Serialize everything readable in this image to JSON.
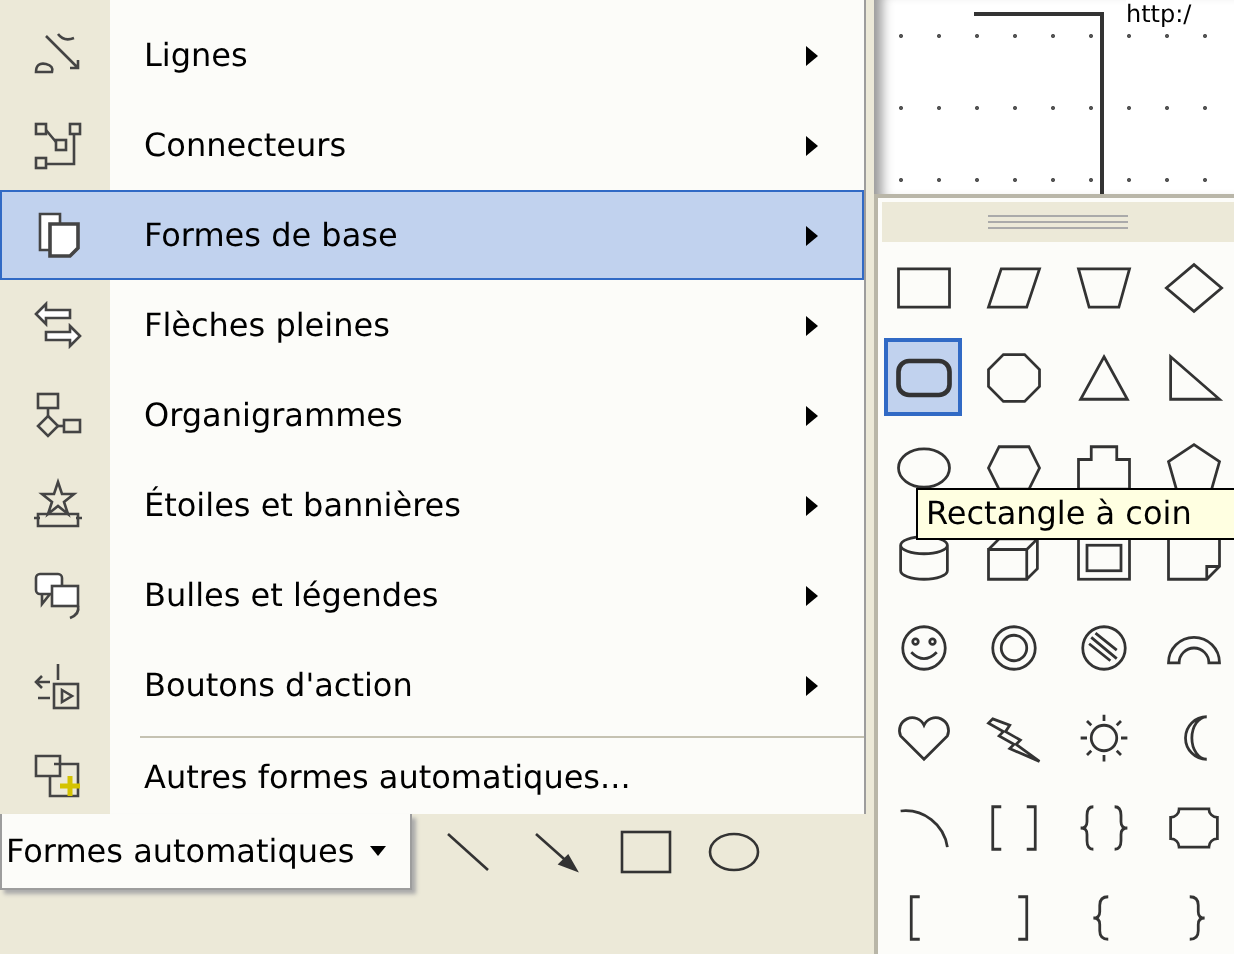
{
  "menu": {
    "items": [
      {
        "label": "Lignes",
        "has_submenu": true,
        "selected": false
      },
      {
        "label": "Connecteurs",
        "has_submenu": true,
        "selected": false
      },
      {
        "label": "Formes de base",
        "has_submenu": true,
        "selected": true
      },
      {
        "label": "Flèches pleines",
        "has_submenu": true,
        "selected": false
      },
      {
        "label": "Organigrammes",
        "has_submenu": true,
        "selected": false
      },
      {
        "label": "Étoiles et bannières",
        "has_submenu": true,
        "selected": false
      },
      {
        "label": "Bulles et légendes",
        "has_submenu": true,
        "selected": false
      },
      {
        "label": "Boutons d'action",
        "has_submenu": true,
        "selected": false
      },
      {
        "label": "Autres formes automatiques...",
        "has_submenu": false,
        "selected": false,
        "separator_before": true
      }
    ]
  },
  "toolbar": {
    "autoshapes_button": "Formes automatiques"
  },
  "canvas": {
    "text": "http:/"
  },
  "palette": {
    "shapes": [
      {
        "kind": "rectangle",
        "selected": false
      },
      {
        "kind": "parallelogram",
        "selected": false
      },
      {
        "kind": "trapezoid",
        "selected": false
      },
      {
        "kind": "diamond",
        "selected": false
      },
      {
        "kind": "rounded-rectangle",
        "selected": true
      },
      {
        "kind": "octagon",
        "selected": false
      },
      {
        "kind": "triangle",
        "selected": false
      },
      {
        "kind": "right-triangle",
        "selected": false
      },
      {
        "kind": "oval",
        "selected": false
      },
      {
        "kind": "hexagon",
        "selected": false
      },
      {
        "kind": "cross",
        "selected": false
      },
      {
        "kind": "pentagon",
        "selected": false
      },
      {
        "kind": "can",
        "selected": false
      },
      {
        "kind": "cube",
        "selected": false
      },
      {
        "kind": "bevel",
        "selected": false
      },
      {
        "kind": "folded-corner",
        "selected": false
      },
      {
        "kind": "smiley",
        "selected": false
      },
      {
        "kind": "donut",
        "selected": false
      },
      {
        "kind": "no-symbol",
        "selected": false
      },
      {
        "kind": "block-arc",
        "selected": false
      },
      {
        "kind": "heart",
        "selected": false
      },
      {
        "kind": "lightning",
        "selected": false
      },
      {
        "kind": "sun",
        "selected": false
      },
      {
        "kind": "moon",
        "selected": false
      },
      {
        "kind": "arc",
        "selected": false
      },
      {
        "kind": "double-bracket",
        "selected": false
      },
      {
        "kind": "double-brace",
        "selected": false
      },
      {
        "kind": "plaque",
        "selected": false
      },
      {
        "kind": "left-bracket",
        "selected": false
      },
      {
        "kind": "right-bracket",
        "selected": false
      },
      {
        "kind": "left-brace",
        "selected": false
      },
      {
        "kind": "right-brace",
        "selected": false
      }
    ]
  },
  "tooltip": {
    "text": "Rectangle à coin"
  }
}
